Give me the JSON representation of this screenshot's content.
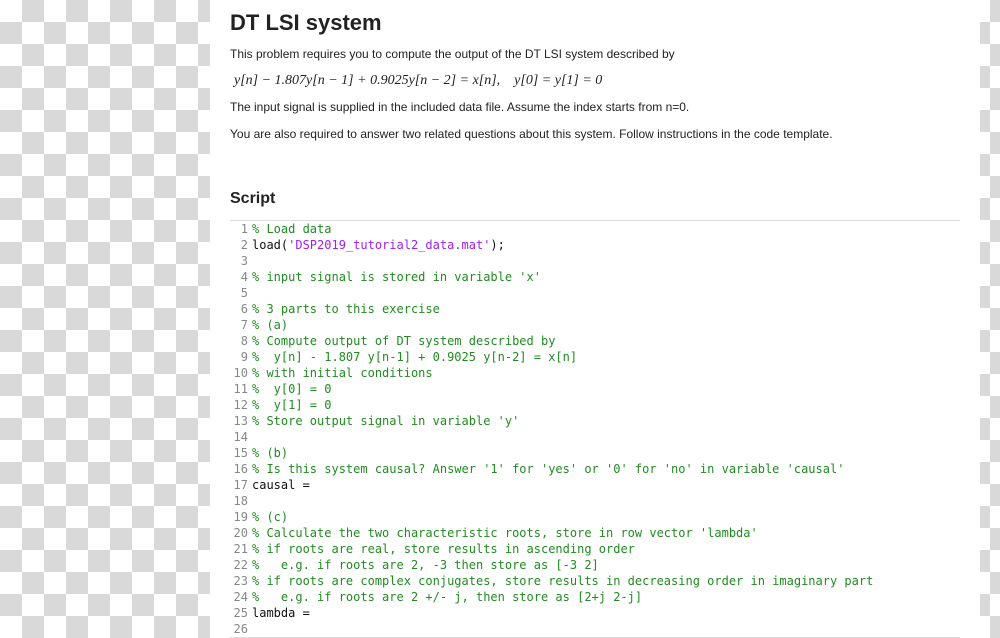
{
  "title": "DT LSI system",
  "paragraphs": {
    "p1": "This problem requires you to compute the output of the DT LSI system described by",
    "p2": "The input signal is supplied in the included data file. Assume the index starts from n=0.",
    "p3": "You are also required to answer two related questions about this system. Follow instructions in the code template."
  },
  "equation": "y[n] − 1.807y[n − 1] + 0.9025y[n − 2] = x[n], y[0] = y[1] = 0",
  "script_heading": "Script",
  "code": [
    {
      "n": 1,
      "tokens": [
        {
          "c": "comment",
          "t": "% Load data"
        }
      ]
    },
    {
      "n": 2,
      "tokens": [
        {
          "c": "plain",
          "t": "load("
        },
        {
          "c": "string",
          "t": "'DSP2019_tutorial2_data.mat'"
        },
        {
          "c": "plain",
          "t": ");"
        }
      ]
    },
    {
      "n": 3,
      "tokens": [
        {
          "c": "plain",
          "t": ""
        }
      ]
    },
    {
      "n": 4,
      "tokens": [
        {
          "c": "comment",
          "t": "% input signal is stored in variable 'x'"
        }
      ]
    },
    {
      "n": 5,
      "tokens": [
        {
          "c": "plain",
          "t": ""
        }
      ]
    },
    {
      "n": 6,
      "tokens": [
        {
          "c": "comment",
          "t": "% 3 parts to this exercise"
        }
      ]
    },
    {
      "n": 7,
      "tokens": [
        {
          "c": "comment",
          "t": "% (a)"
        }
      ]
    },
    {
      "n": 8,
      "tokens": [
        {
          "c": "comment",
          "t": "% Compute output of DT system described by"
        }
      ]
    },
    {
      "n": 9,
      "tokens": [
        {
          "c": "comment",
          "t": "%  y[n] - 1.807 y[n-1] + 0.9025 y[n-2] = x[n]"
        }
      ]
    },
    {
      "n": 10,
      "tokens": [
        {
          "c": "comment",
          "t": "% with initial conditions"
        }
      ]
    },
    {
      "n": 11,
      "tokens": [
        {
          "c": "comment",
          "t": "%  y[0] = 0"
        }
      ]
    },
    {
      "n": 12,
      "tokens": [
        {
          "c": "comment",
          "t": "%  y[1] = 0"
        }
      ]
    },
    {
      "n": 13,
      "tokens": [
        {
          "c": "comment",
          "t": "% Store output signal in variable 'y'"
        }
      ]
    },
    {
      "n": 14,
      "tokens": [
        {
          "c": "plain",
          "t": ""
        }
      ]
    },
    {
      "n": 15,
      "tokens": [
        {
          "c": "comment",
          "t": "% (b)"
        }
      ]
    },
    {
      "n": 16,
      "tokens": [
        {
          "c": "comment",
          "t": "% Is this system causal? Answer '1' for 'yes' or '0' for 'no' in variable 'causal'"
        }
      ]
    },
    {
      "n": 17,
      "tokens": [
        {
          "c": "plain",
          "t": "causal = "
        }
      ]
    },
    {
      "n": 18,
      "tokens": [
        {
          "c": "plain",
          "t": ""
        }
      ]
    },
    {
      "n": 19,
      "tokens": [
        {
          "c": "comment",
          "t": "% (c)"
        }
      ]
    },
    {
      "n": 20,
      "tokens": [
        {
          "c": "comment",
          "t": "% Calculate the two characteristic roots, store in row vector 'lambda'"
        }
      ]
    },
    {
      "n": 21,
      "tokens": [
        {
          "c": "comment",
          "t": "% if roots are real, store results in ascending order"
        }
      ]
    },
    {
      "n": 22,
      "tokens": [
        {
          "c": "comment",
          "t": "%   e.g. if roots are 2, -3 then store as [-3 2]"
        }
      ]
    },
    {
      "n": 23,
      "tokens": [
        {
          "c": "comment",
          "t": "% if roots are complex conjugates, store results in decreasing order in imaginary part"
        }
      ]
    },
    {
      "n": 24,
      "tokens": [
        {
          "c": "comment",
          "t": "%   e.g. if roots are 2 +/- j, then store as [2+j 2-j]"
        }
      ]
    },
    {
      "n": 25,
      "tokens": [
        {
          "c": "plain",
          "t": "lambda = "
        }
      ]
    },
    {
      "n": 26,
      "tokens": [
        {
          "c": "plain",
          "t": ""
        }
      ]
    }
  ]
}
